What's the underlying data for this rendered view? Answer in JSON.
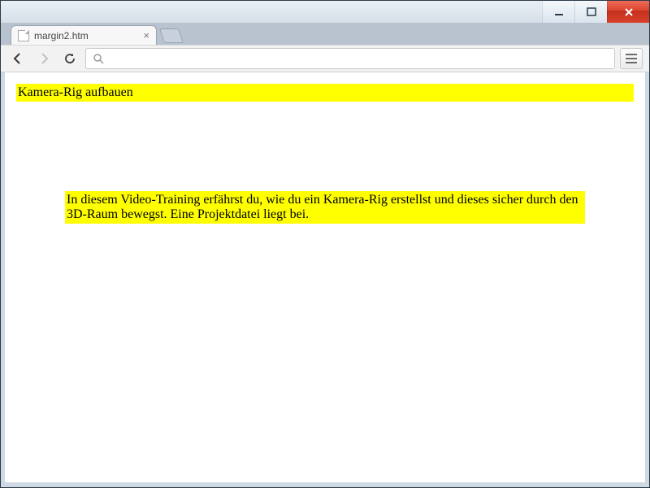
{
  "window": {
    "tab_title": "margin2.htm"
  },
  "toolbar": {
    "omnibox_value": ""
  },
  "page": {
    "heading": "Kamera-Rig aufbauen",
    "paragraph": "In diesem Video-Training erfährst du, wie du ein Kamera-Rig erstellst und dieses sicher durch den 3D-Raum bewegst. Eine Projektdatei liegt bei."
  }
}
